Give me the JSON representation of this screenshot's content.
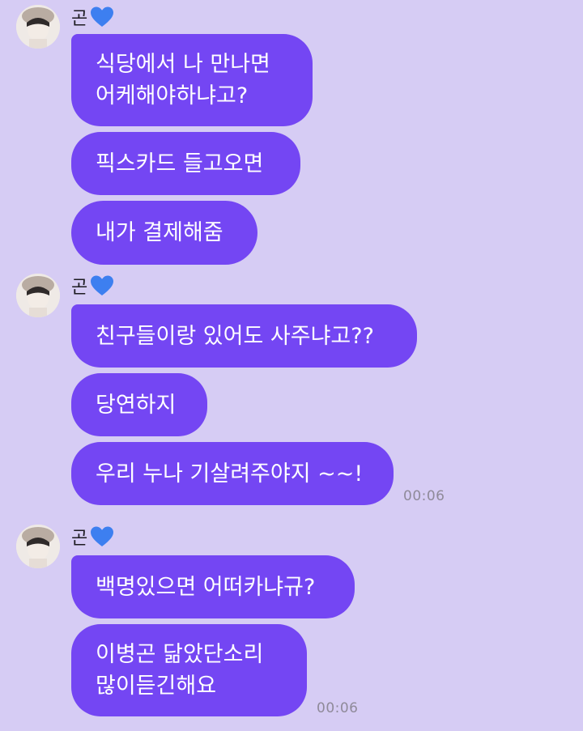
{
  "groups": [
    {
      "sender": "곤",
      "messages": [
        {
          "lines": [
            "식당에서 나 만나면",
            "어케해야하냐고?"
          ]
        },
        {
          "lines": [
            "픽스카드 들고오면"
          ]
        },
        {
          "lines": [
            "내가 결제해줌"
          ]
        }
      ]
    },
    {
      "sender": "곤",
      "messages": [
        {
          "lines": [
            "친구들이랑 있어도 사주냐고??"
          ]
        },
        {
          "lines": [
            "당연하지"
          ]
        },
        {
          "lines": [
            "우리 누나 기살려주야지 ~~!"
          ]
        }
      ],
      "timestamp": "00:06"
    },
    {
      "sender": "곤",
      "messages": [
        {
          "lines": [
            "백명있으면 어떠카냐규?"
          ]
        },
        {
          "lines": [
            "이병곤 닮았단소리",
            "많이듣긴해요"
          ]
        }
      ],
      "timestamp": "00:06"
    }
  ],
  "colors": {
    "background": "#d6ccf4",
    "bubble": "#7446f3",
    "bubble_text": "#ffffff",
    "timestamp": "#8f8a99",
    "heart": "#3d7ff0"
  },
  "icons": {
    "avatar": "profile-photo-avatar",
    "heart": "blue-heart-emoji"
  }
}
